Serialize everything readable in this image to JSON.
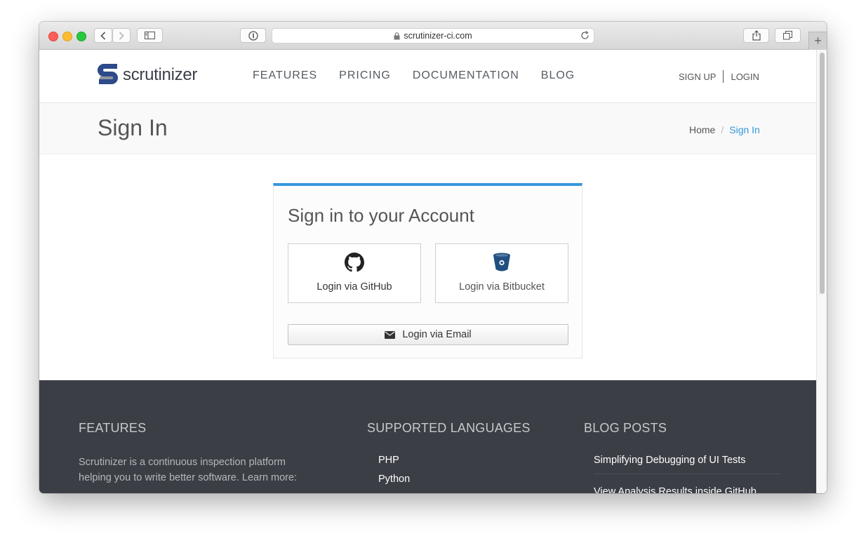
{
  "browser": {
    "url": "scrutinizer-ci.com"
  },
  "nav": {
    "logo_text": "scrutinizer",
    "links": [
      "FEATURES",
      "PRICING",
      "DOCUMENTATION",
      "BLOG"
    ],
    "sign_up": "SIGN UP",
    "login": "LOGIN"
  },
  "title_bar": {
    "title": "Sign In",
    "breadcrumbs": [
      "Home",
      "/",
      "Sign In"
    ]
  },
  "signin_card": {
    "title": "Sign in to your Account",
    "github_label": "Login via GitHub",
    "bitbucket_label": "Login via Bitbucket",
    "email_label": "Login via Email",
    "accent_color": "#3498db"
  },
  "footer": {
    "features_heading": "FEATURES",
    "features_text": "Scrutinizer is a continuous inspection platform helping you to write better software. Learn more:",
    "languages_heading": "SUPPORTED LANGUAGES",
    "languages": [
      "PHP",
      "Python"
    ],
    "blog_heading": "BLOG POSTS",
    "blog_posts": [
      "Simplifying Debugging of UI Tests",
      "View Analysis Results inside GitHub"
    ]
  },
  "colors": {
    "footer_bg": "#3b3e45",
    "link_active": "#3498db",
    "logo_blue": "#2d4a8a"
  }
}
